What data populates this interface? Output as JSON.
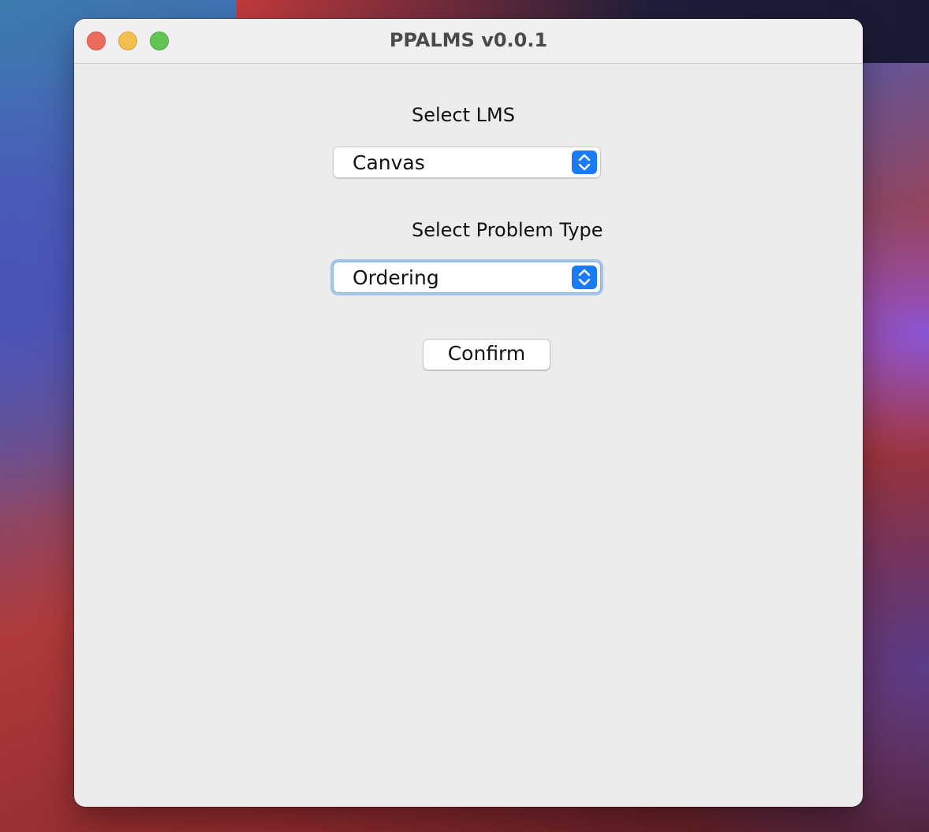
{
  "window": {
    "title": "PPALMS v0.0.1"
  },
  "lms": {
    "label": "Select LMS",
    "selected": "Canvas"
  },
  "problem_type": {
    "label": "Select Problem Type",
    "selected": "Ordering"
  },
  "actions": {
    "confirm_label": "Confirm"
  },
  "colors": {
    "accent": "#1b7bf4",
    "window_bg": "#ececec",
    "close": "#ed6a5e",
    "minimize": "#f5bf4f",
    "maximize": "#61c554"
  }
}
